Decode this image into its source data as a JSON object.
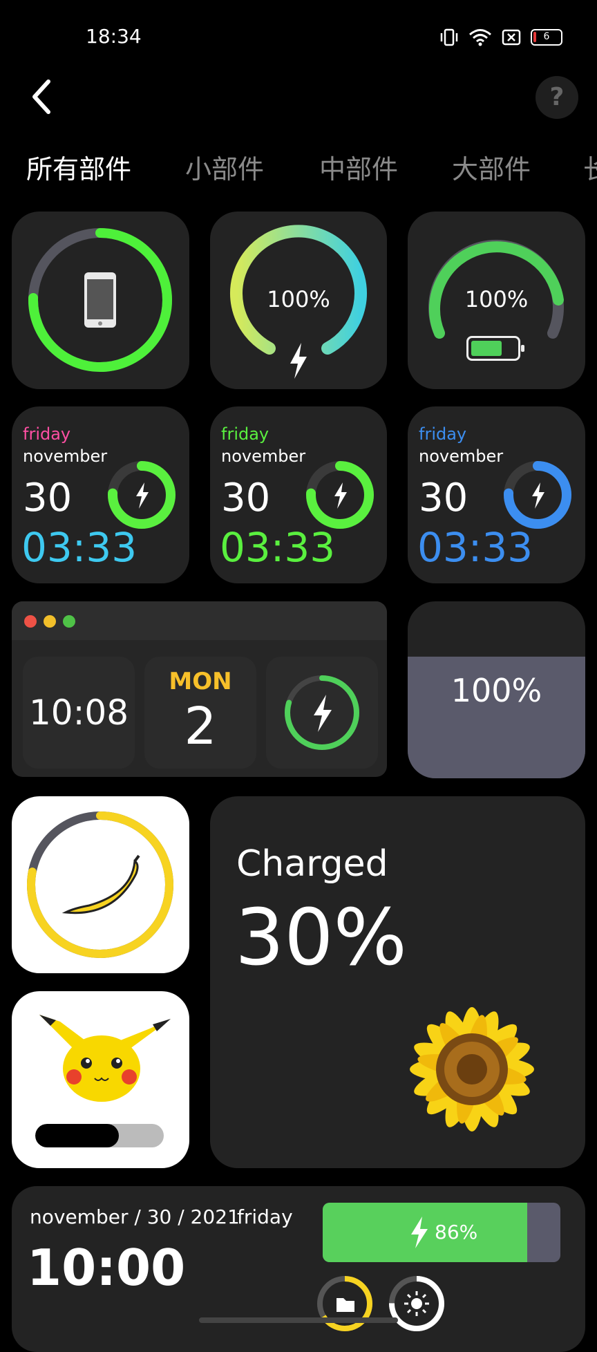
{
  "status": {
    "time": "18:34",
    "battery_level": "6"
  },
  "icons": {
    "back": "chevron-left-icon",
    "help": "question-icon"
  },
  "help_label": "?",
  "tabs": [
    "所有部件",
    "小部件",
    "中部件",
    "大部件",
    "长"
  ],
  "row1": {
    "percent_a": "100%",
    "percent_b": "100%"
  },
  "date_widgets": [
    {
      "day": "friday",
      "month": "november",
      "date": "30",
      "time": "03:33",
      "day_color": "#ff4fa3",
      "clock_color": "#3ec9f0",
      "ring_color": "#5af03f"
    },
    {
      "day": "friday",
      "month": "november",
      "date": "30",
      "time": "03:33",
      "day_color": "#5af03f",
      "clock_color": "#5af03f",
      "ring_color": "#5af03f"
    },
    {
      "day": "friday",
      "month": "november",
      "date": "30",
      "time": "03:33",
      "day_color": "#3c8ef0",
      "clock_color": "#3c8ef0",
      "ring_color": "#3c8ef0"
    }
  ],
  "window_widget": {
    "time": "10:08",
    "weekday": "MON",
    "day": "2"
  },
  "fill_widget": {
    "percent": "100%"
  },
  "charged_widget": {
    "label": "Charged",
    "percent": "30%"
  },
  "pikachu_progress": 0.65,
  "bottom_widget": {
    "date": "november / 30 / 2021",
    "weekday": "friday",
    "time": "10:00",
    "battery": "86%",
    "battery_level": 0.86
  }
}
